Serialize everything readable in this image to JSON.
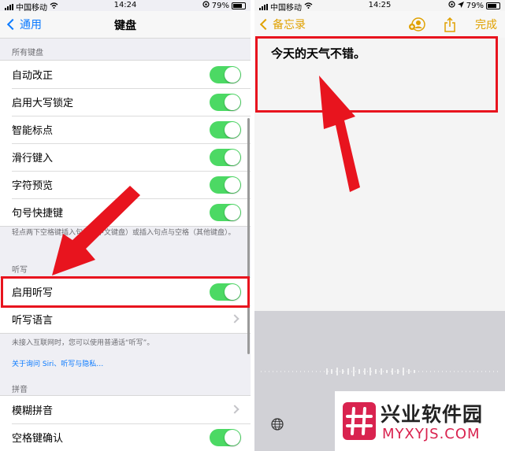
{
  "left": {
    "status": {
      "carrier": "中国移动",
      "time": "14:24",
      "battery": "79%"
    },
    "nav": {
      "back_label": "通用",
      "title": "键盘"
    },
    "all_keyboards": {
      "header": "所有键盘",
      "items": [
        {
          "label": "自动改正",
          "on": true
        },
        {
          "label": "启用大写锁定",
          "on": true
        },
        {
          "label": "智能标点",
          "on": true
        },
        {
          "label": "滑行键入",
          "on": true
        },
        {
          "label": "字符预览",
          "on": true
        },
        {
          "label": "句号快捷键",
          "on": true
        }
      ],
      "footer": "轻点两下空格键插入句号（中文键盘）或插入句点与空格（其他键盘）。"
    },
    "dictation": {
      "header": "听写",
      "enable_label": "启用听写",
      "language_label": "听写语言",
      "footer": "未接入互联网时，您可以使用普通话“听写”。",
      "link": "关于询问 Siri、听写与隐私…"
    },
    "pinyin": {
      "header": "拼音",
      "fuzzy_label": "模糊拼音",
      "space_confirm_label": "空格键确认"
    }
  },
  "right": {
    "status": {
      "carrier": "中国移动",
      "time": "14:25",
      "battery": "79%"
    },
    "nav": {
      "back_label": "备忘录",
      "done_label": "完成"
    },
    "note_text": "今天的天气不错。"
  },
  "watermark": {
    "title": "兴业软件园",
    "subtitle": "MYXYJS.COM"
  },
  "colors": {
    "ios_blue": "#0a7aff",
    "toggle_green": "#4cd964",
    "notes_yellow": "#e0a100",
    "highlight_red": "#e8141e"
  }
}
